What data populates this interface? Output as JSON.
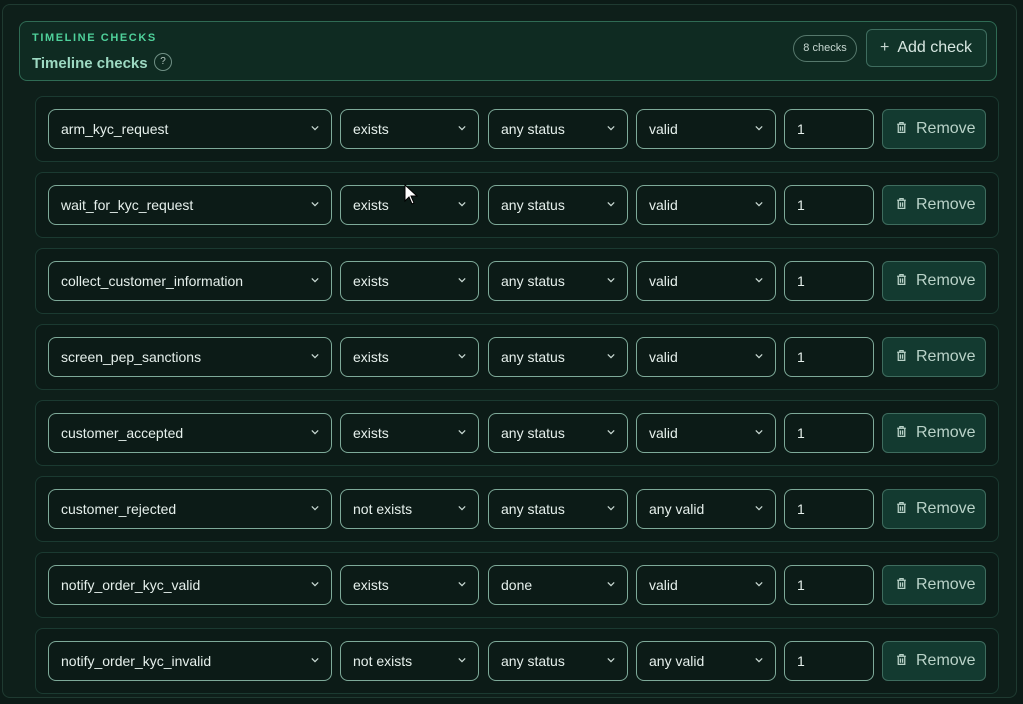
{
  "header": {
    "kicker": "TIMELINE CHECKS",
    "title": "Timeline checks",
    "help_label": "?",
    "count_label": "8 checks",
    "add_label": "Add check"
  },
  "rows": [
    {
      "name": "arm_kyc_request",
      "existence": "exists",
      "status": "any status",
      "validity": "valid",
      "count": "1",
      "remove_label": "Remove"
    },
    {
      "name": "wait_for_kyc_request",
      "existence": "exists",
      "status": "any status",
      "validity": "valid",
      "count": "1",
      "remove_label": "Remove"
    },
    {
      "name": "collect_customer_information",
      "existence": "exists",
      "status": "any status",
      "validity": "valid",
      "count": "1",
      "remove_label": "Remove"
    },
    {
      "name": "screen_pep_sanctions",
      "existence": "exists",
      "status": "any status",
      "validity": "valid",
      "count": "1",
      "remove_label": "Remove"
    },
    {
      "name": "customer_accepted",
      "existence": "exists",
      "status": "any status",
      "validity": "valid",
      "count": "1",
      "remove_label": "Remove"
    },
    {
      "name": "customer_rejected",
      "existence": "not exists",
      "status": "any status",
      "validity": "any valid",
      "count": "1",
      "remove_label": "Remove"
    },
    {
      "name": "notify_order_kyc_valid",
      "existence": "exists",
      "status": "done",
      "validity": "valid",
      "count": "1",
      "remove_label": "Remove"
    },
    {
      "name": "notify_order_kyc_invalid",
      "existence": "not exists",
      "status": "any status",
      "validity": "any valid",
      "count": "1",
      "remove_label": "Remove"
    }
  ],
  "icons": {
    "add": "plus-icon",
    "remove": "trash-icon",
    "dropdown": "chevron-down-icon",
    "help": "help-icon"
  },
  "colors": {
    "accent": "#4fd19b",
    "background": "#0c1b17",
    "header_bg": "#0f2b22",
    "border": "#7eaa99"
  }
}
